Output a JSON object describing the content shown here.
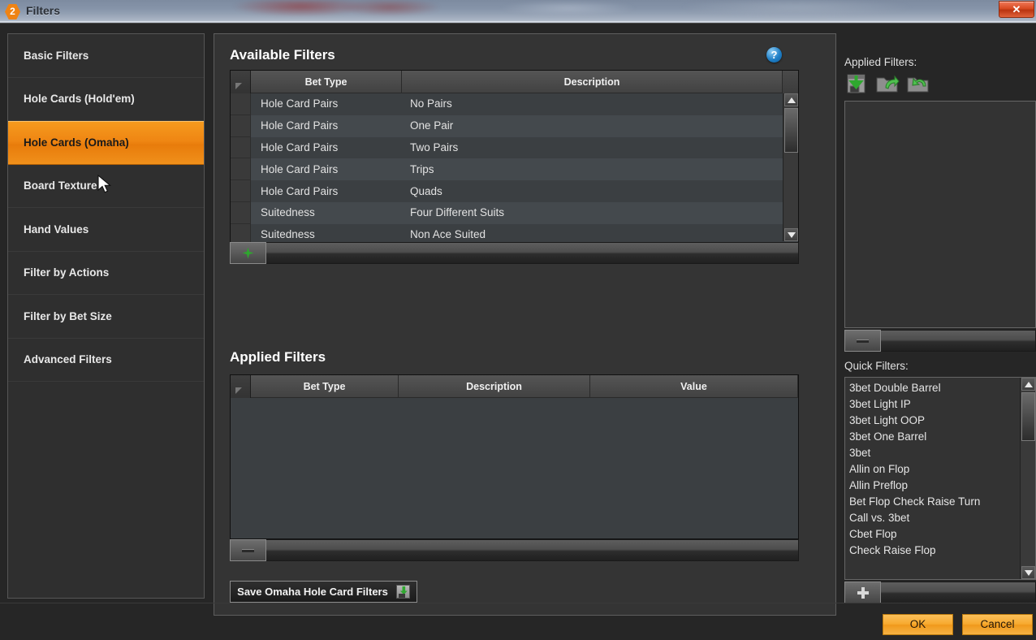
{
  "window": {
    "badge": "2",
    "title": "Filters",
    "close_label": "✕"
  },
  "sidebar": {
    "items": [
      {
        "label": "Basic Filters",
        "selected": false
      },
      {
        "label": "Hole Cards (Hold'em)",
        "selected": false
      },
      {
        "label": "Hole Cards (Omaha)",
        "selected": true
      },
      {
        "label": "Board Texture",
        "selected": false
      },
      {
        "label": "Hand Values",
        "selected": false
      },
      {
        "label": "Filter by Actions",
        "selected": false
      },
      {
        "label": "Filter by Bet Size",
        "selected": false
      },
      {
        "label": "Advanced Filters",
        "selected": false
      }
    ]
  },
  "available_filters": {
    "title": "Available Filters",
    "help_icon": "help-icon",
    "columns": [
      "Bet Type",
      "Description"
    ],
    "rows": [
      {
        "bet_type": "Hole Card Pairs",
        "description": "No Pairs"
      },
      {
        "bet_type": "Hole Card Pairs",
        "description": "One Pair"
      },
      {
        "bet_type": "Hole Card Pairs",
        "description": "Two Pairs"
      },
      {
        "bet_type": "Hole Card Pairs",
        "description": "Trips"
      },
      {
        "bet_type": "Hole Card Pairs",
        "description": "Quads"
      },
      {
        "bet_type": "Suitedness",
        "description": "Four Different Suits"
      },
      {
        "bet_type": "Suitedness",
        "description": "Non Ace Suited"
      }
    ],
    "add_button_icon": "green-plus-star-icon"
  },
  "applied_filters_grid": {
    "title": "Applied Filters",
    "columns": [
      "Bet Type",
      "Description",
      "Value"
    ],
    "rows": [],
    "remove_button_icon": "minus-icon"
  },
  "save_button": {
    "label": "Save Omaha Hole Card Filters",
    "icon": "save-disk-icon"
  },
  "right_panel": {
    "applied_filters_label": "Applied Filters:",
    "toolbar": [
      {
        "name": "save-filters-icon"
      },
      {
        "name": "open-folder-icon"
      },
      {
        "name": "reload-folder-icon"
      }
    ],
    "applied_list": [],
    "applied_remove_icon": "minus-icon",
    "quick_filters_label": "Quick Filters:",
    "quick_filters": [
      "3bet Double Barrel",
      "3bet Light IP",
      "3bet Light OOP",
      "3bet One Barrel",
      "3bet",
      "Allin on Flop",
      "Allin Preflop",
      "Bet Flop Check Raise Turn",
      "Call vs. 3bet",
      "Cbet Flop",
      "Check Raise Flop"
    ],
    "quick_add_icon": "plus-icon"
  },
  "footer": {
    "ok_label": "OK",
    "cancel_label": "Cancel"
  },
  "colors": {
    "accent_orange": "#ef8613",
    "window_bg": "#262626",
    "panel_bg": "#343434",
    "grid_row_odd": "#3b3f42",
    "grid_row_even": "#44494d",
    "help_blue": "#1f7fc6",
    "green": "#2ea62e"
  }
}
